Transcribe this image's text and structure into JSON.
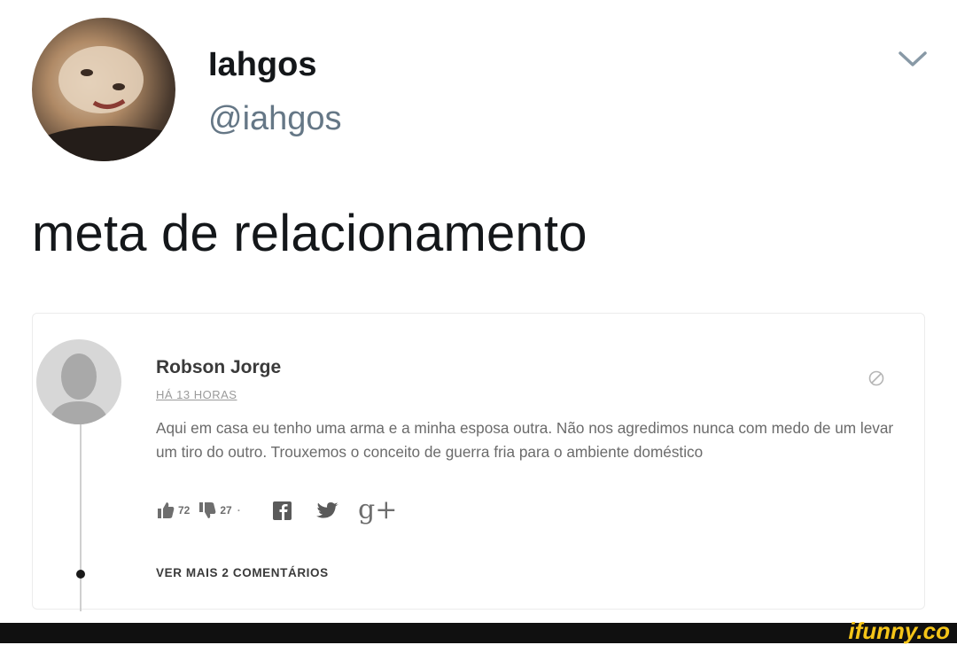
{
  "tweet": {
    "display_name": "Iahgos",
    "handle": "@iahgos",
    "text": "meta de relacionamento",
    "menu_icon": "chevron-down-icon"
  },
  "comment": {
    "author": "Robson Jorge",
    "time": "HÁ 13 HORAS",
    "text": "Aqui em casa eu tenho uma arma e a minha esposa outra. Não nos agredimos nunca com medo de um levar um tiro do outro. Trouxemos o conceito de guerra fria para o ambiente doméstico",
    "likes": "72",
    "dislikes": "27",
    "separator": "·",
    "share_icons": [
      "facebook-icon",
      "twitter-icon",
      "google-plus-icon"
    ],
    "google_plus_label": "g+",
    "more_comments": "VER MAIS 2 COMENTÁRIOS"
  },
  "footer": {
    "brand": "ifunny.co",
    "brand_color": "#f5c518"
  }
}
